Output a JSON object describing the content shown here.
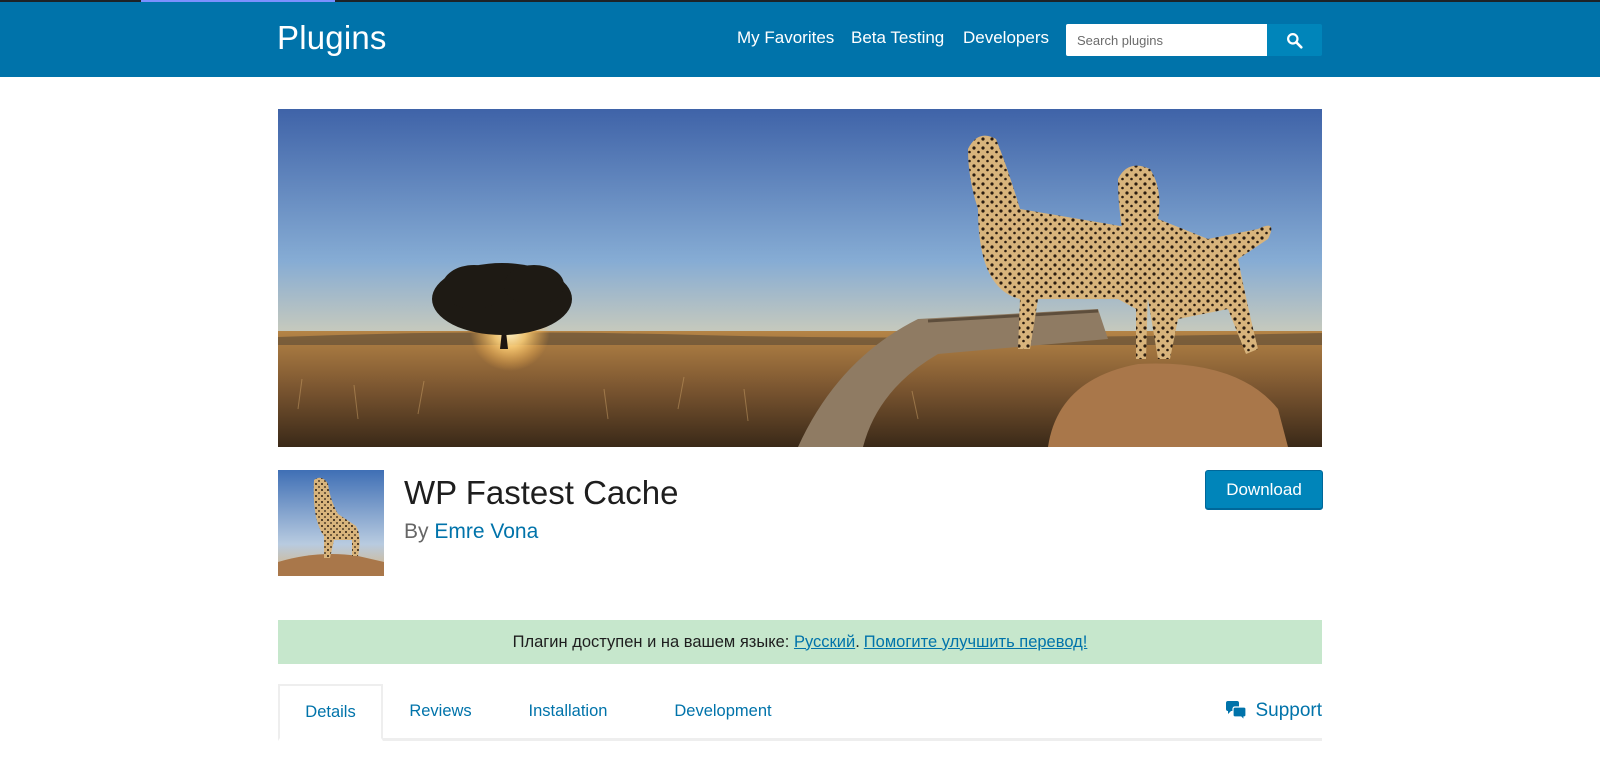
{
  "header": {
    "title": "Plugins",
    "nav": [
      "My Favorites",
      "Beta Testing",
      "Developers"
    ],
    "search_placeholder": "Search plugins"
  },
  "plugin": {
    "name": "WP Fastest Cache",
    "by_prefix": "By",
    "author": "Emre Vona",
    "download_label": "Download"
  },
  "notice": {
    "text": "Плагин доступен и на вашем языке: ",
    "language_link": "Русский",
    "separator": ".",
    "help_link": "Помогите улучшить перевод!"
  },
  "tabs": [
    "Details",
    "Reviews",
    "Installation",
    "Development"
  ],
  "support_label": "Support",
  "colors": {
    "header_bg": "#0073aa",
    "link": "#0073aa",
    "button": "#0085ba",
    "notice_bg": "#c6e7cc"
  },
  "icons": {
    "search": "search-icon",
    "support": "support-chat-icon"
  }
}
